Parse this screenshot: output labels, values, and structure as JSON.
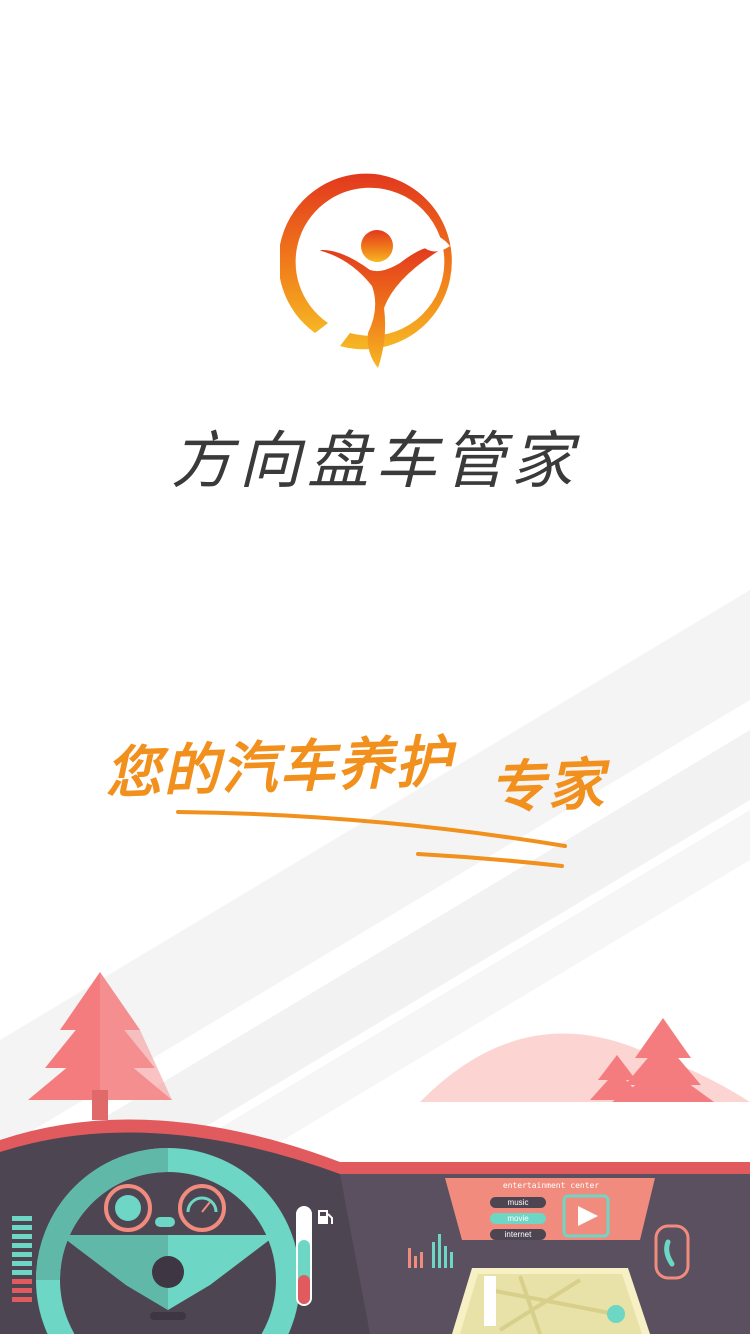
{
  "app": {
    "title": "方向盘车管家"
  },
  "slogan": {
    "text_main": "您的汽车养护",
    "text_emph": "专家"
  },
  "entertainment": {
    "title": "entertainment center",
    "buttons": [
      "music",
      "movie",
      "internet"
    ]
  },
  "colors": {
    "brand_orange": "#f2901d",
    "logo_red": "#e0401f",
    "dash_dark": "#4e4552",
    "dash_teal": "#6dd6c4",
    "dash_coral": "#f08b7e",
    "tree_pink": "#f28e8e"
  },
  "icons": [
    "steering-wheel-logo-icon",
    "fuel-icon",
    "phone-icon",
    "play-icon",
    "location-icon"
  ]
}
